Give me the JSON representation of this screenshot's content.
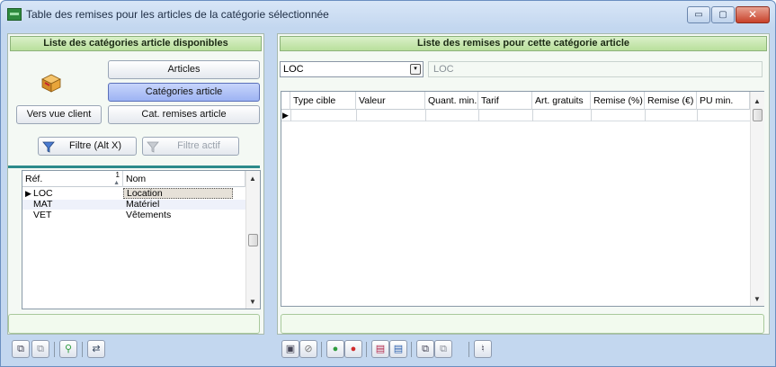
{
  "window": {
    "title": "Table des remises pour les articles de la catégorie sélectionnée",
    "controls": {
      "minimize": "▭",
      "maximize": "▢",
      "close": "✕"
    }
  },
  "left_panel": {
    "header": "Liste des catégories article disponibles",
    "buttons": {
      "articles": "Articles",
      "categories_article": "Catégories article",
      "vers_vue_client": "Vers vue client",
      "cat_remises_article": "Cat. remises article",
      "filtre": "Filtre (Alt X)",
      "filtre_actif": "Filtre actif"
    },
    "grid": {
      "columns": [
        {
          "label": "Réf.",
          "sort_index": "1"
        },
        {
          "label": "Nom"
        }
      ],
      "rows": [
        {
          "ref": "LOC",
          "nom": "Location",
          "current": true
        },
        {
          "ref": "MAT",
          "nom": "Matériel",
          "current": false
        },
        {
          "ref": "VET",
          "nom": "Vêtements",
          "current": false
        }
      ]
    }
  },
  "right_panel": {
    "header": "Liste des remises pour cette catégorie article",
    "category_select": {
      "value": "LOC"
    },
    "category_label": "LOC",
    "grid": {
      "columns": [
        "Type cible",
        "Valeur",
        "Quant. min.",
        "Tarif",
        "Art. gratuits",
        "Remise (%)",
        "Remise (€)",
        "PU min."
      ]
    }
  },
  "icons": {
    "row_pointer": "▶",
    "scroll_up": "▲",
    "scroll_down": "▼",
    "select_dropdown": "▾"
  },
  "colors": {
    "header_green": "#b9df9c",
    "selected_button": "#9db3f3",
    "current_row": "#e6e1d8"
  }
}
